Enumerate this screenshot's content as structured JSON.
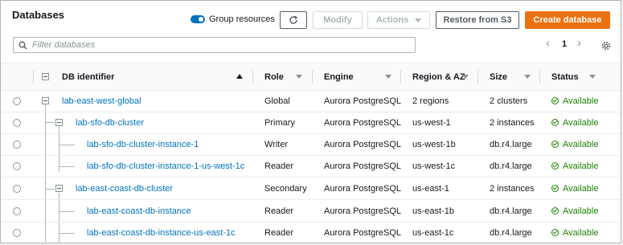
{
  "header": {
    "title": "Databases",
    "group_resources_label": "Group resources",
    "modify_label": "Modify",
    "actions_label": "Actions",
    "restore_label": "Restore from S3",
    "create_label": "Create database"
  },
  "search": {
    "placeholder": "Filter databases",
    "value": ""
  },
  "pagination": {
    "prev": "‹",
    "page": "1",
    "next": "›"
  },
  "columns": {
    "identifier": "DB identifier",
    "role": "Role",
    "engine": "Engine",
    "region": "Region & AZ",
    "size": "Size",
    "status": "Status"
  },
  "rows": [
    {
      "identifier": "lab-east-west-global",
      "role": "Global",
      "engine": "Aurora PostgreSQL",
      "region": "2 regions",
      "size": "2 clusters",
      "status": "Available"
    },
    {
      "identifier": "lab-sfo-db-cluster",
      "role": "Primary",
      "engine": "Aurora PostgreSQL",
      "region": "us-west-1",
      "size": "2 instances",
      "status": "Available"
    },
    {
      "identifier": "lab-sfo-db-cluster-instance-1",
      "role": "Writer",
      "engine": "Aurora PostgreSQL",
      "region": "us-west-1b",
      "size": "db.r4.large",
      "status": "Available"
    },
    {
      "identifier": "lab-sfo-db-cluster-instance-1-us-west-1c",
      "role": "Reader",
      "engine": "Aurora PostgreSQL",
      "region": "us-west-1c",
      "size": "db.r4.large",
      "status": "Available"
    },
    {
      "identifier": "lab-east-coast-db-cluster",
      "role": "Secondary",
      "engine": "Aurora PostgreSQL",
      "region": "us-east-1",
      "size": "2 instances",
      "status": "Available"
    },
    {
      "identifier": "lab-east-coast-db-instance",
      "role": "Reader",
      "engine": "Aurora PostgreSQL",
      "region": "us-east-1b",
      "size": "db.r4.large",
      "status": "Available"
    },
    {
      "identifier": "lab-east-coast-db-instance-us-east-1c",
      "role": "Reader",
      "engine": "Aurora PostgreSQL",
      "region": "us-east-1c",
      "size": "db.r4.large",
      "status": "Available"
    }
  ],
  "colors": {
    "accent": "#ec7211",
    "link": "#0073bb",
    "success": "#1d8102"
  }
}
